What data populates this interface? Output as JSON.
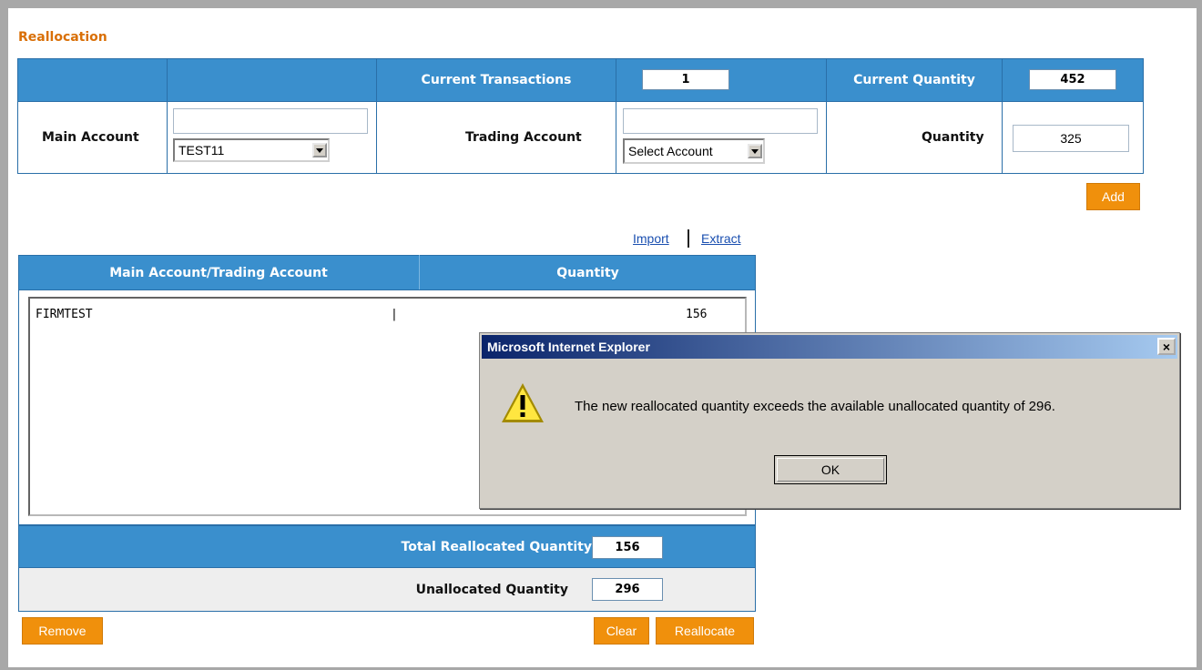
{
  "section_title": "Reallocation",
  "header_row": {
    "current_transactions_label": "Current Transactions",
    "current_transactions_value": "1",
    "current_quantity_label": "Current Quantity",
    "current_quantity_value": "452"
  },
  "form_row": {
    "main_account_label": "Main Account",
    "main_account_input_value": "",
    "main_account_select": "TEST11",
    "trading_account_label": "Trading Account",
    "trading_account_input_value": "",
    "trading_account_select": "Select Account",
    "quantity_label": "Quantity",
    "quantity_value": "325"
  },
  "add_button": "Add",
  "links": {
    "import": "Import",
    "extract": "Extract"
  },
  "allocation_table": {
    "col_account": "Main Account/Trading Account",
    "col_quantity": "Quantity",
    "rows": [
      {
        "account": "FIRMTEST",
        "separator": "|",
        "quantity": "156"
      }
    ],
    "total_label": "Total Reallocated Quantity",
    "total_value": "156",
    "unallocated_label": "Unallocated Quantity",
    "unallocated_value": "296"
  },
  "buttons": {
    "remove": "Remove",
    "clear": "Clear",
    "reallocate": "Reallocate"
  },
  "dialog": {
    "title": "Microsoft Internet Explorer",
    "close": "×",
    "message": "The new reallocated quantity exceeds the available unallocated quantity of 296.",
    "ok": "OK",
    "icon": "warning-icon"
  },
  "colors": {
    "header_blue": "#3a8fcd",
    "accent_orange": "#f0900c",
    "title_orange": "#d96f06"
  }
}
